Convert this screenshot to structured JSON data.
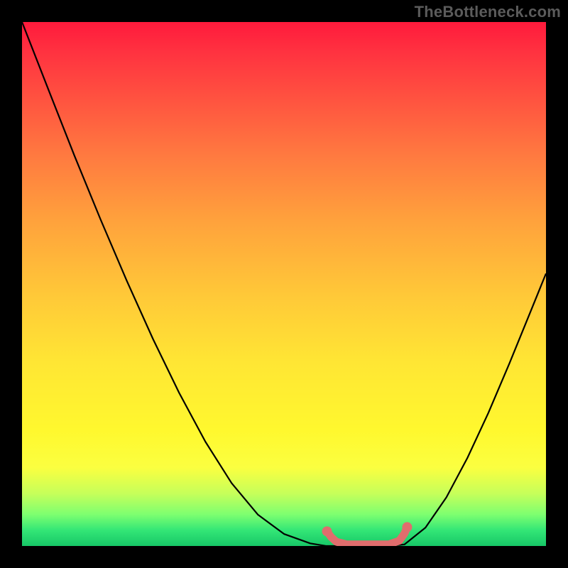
{
  "watermark": "TheBottleneck.com",
  "chart_data": {
    "type": "line",
    "title": "",
    "xlabel": "",
    "ylabel": "",
    "xlim": [
      0,
      1
    ],
    "ylim": [
      0,
      1
    ],
    "series": [
      {
        "name": "bottleneck-curve",
        "color": "#000000",
        "x": [
          0.0,
          0.05,
          0.1,
          0.15,
          0.2,
          0.25,
          0.3,
          0.35,
          0.4,
          0.45,
          0.5,
          0.55,
          0.58,
          0.61,
          0.64,
          0.67,
          0.7,
          0.73,
          0.77,
          0.81,
          0.85,
          0.89,
          0.93,
          0.97,
          1.0
        ],
        "y": [
          1.0,
          0.872,
          0.745,
          0.623,
          0.506,
          0.395,
          0.292,
          0.199,
          0.12,
          0.06,
          0.023,
          0.005,
          0.0,
          0.0,
          0.0,
          0.0,
          0.0,
          0.003,
          0.035,
          0.093,
          0.168,
          0.254,
          0.348,
          0.446,
          0.52
        ]
      },
      {
        "name": "optimal-band",
        "color": "#e06d6d",
        "x": [
          0.582,
          0.59,
          0.6,
          0.62,
          0.66,
          0.7,
          0.72,
          0.73,
          0.735
        ],
        "y": [
          0.028,
          0.017,
          0.008,
          0.003,
          0.003,
          0.003,
          0.01,
          0.024,
          0.036
        ]
      }
    ],
    "markers": [
      {
        "name": "band-start-dot",
        "x": 0.582,
        "y": 0.028,
        "r": 7,
        "color": "#e06d6d"
      },
      {
        "name": "band-end-dot",
        "x": 0.735,
        "y": 0.036,
        "r": 7,
        "color": "#e06d6d"
      }
    ],
    "background_gradient": {
      "top": "#ff1a3c",
      "mid": "#ffe634",
      "bottom": "#17c767"
    }
  }
}
